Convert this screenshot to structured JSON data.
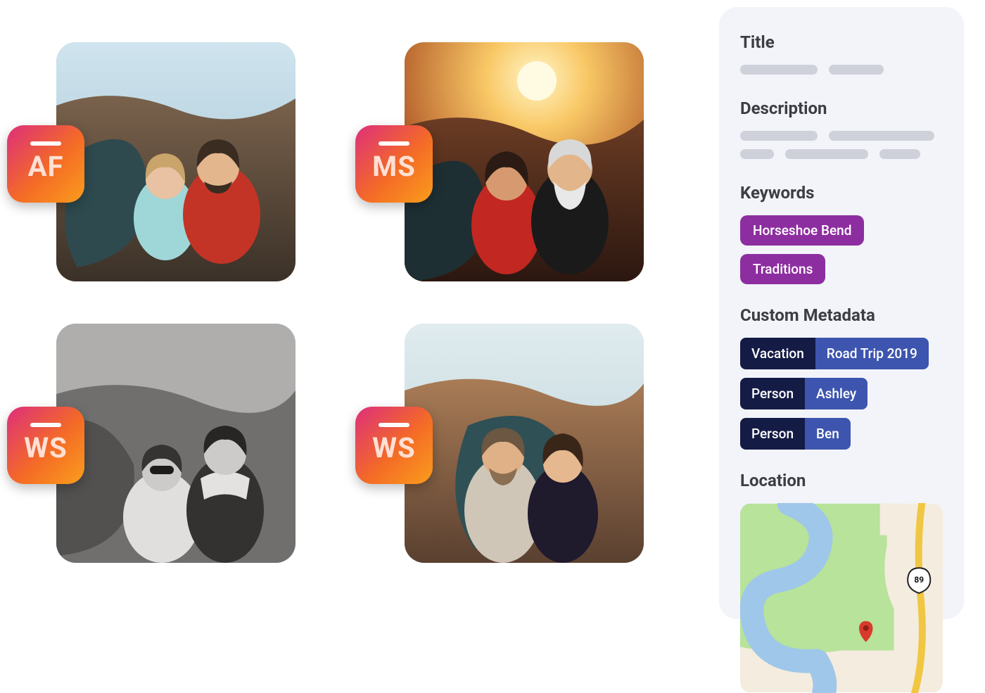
{
  "gallery": {
    "items": [
      {
        "badge": "AF"
      },
      {
        "badge": "MS"
      },
      {
        "badge": "WS"
      },
      {
        "badge": "WS"
      }
    ]
  },
  "sidebar": {
    "title_label": "Title",
    "description_label": "Description",
    "keywords_label": "Keywords",
    "keywords": [
      "Horseshoe Bend",
      "Traditions"
    ],
    "custom_meta_label": "Custom Metadata",
    "custom_meta": [
      {
        "key": "Vacation",
        "value": "Road Trip 2019"
      },
      {
        "key": "Person",
        "value": "Ashley"
      },
      {
        "key": "Person",
        "value": "Ben"
      }
    ],
    "location_label": "Location",
    "route_label": "89"
  }
}
